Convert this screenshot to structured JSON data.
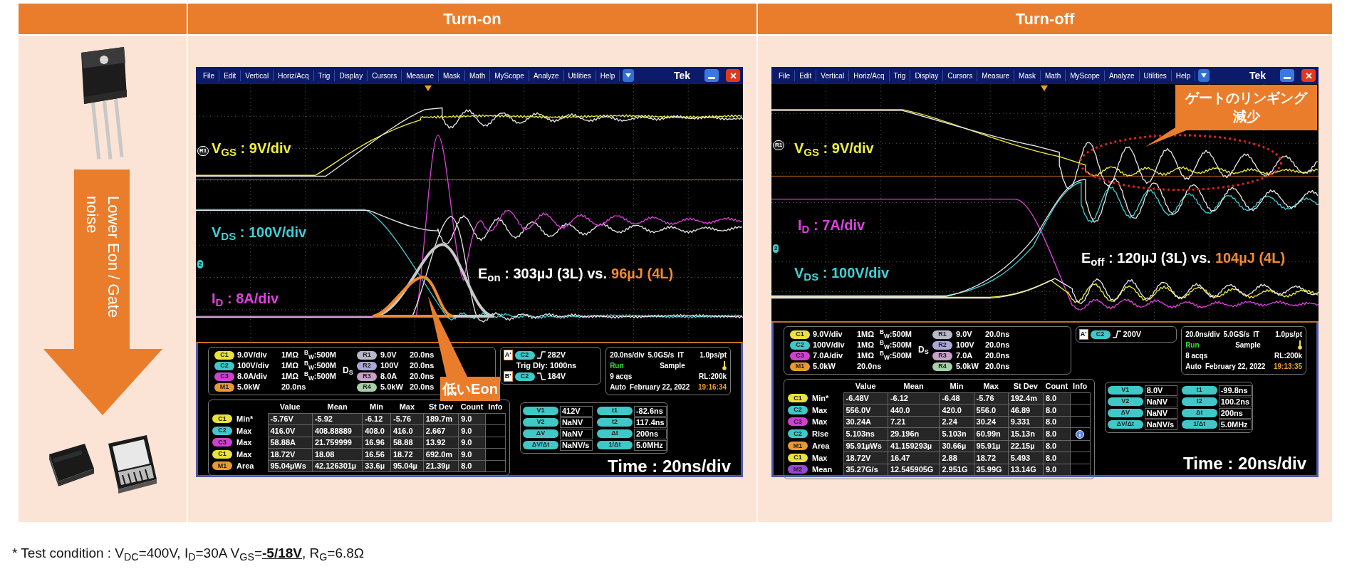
{
  "left_panel": {
    "arrow_label": "Lower Eon / Gate noise"
  },
  "sections": [
    {
      "title": "Turn-on",
      "scope": {
        "menu": [
          "File",
          "Edit",
          "Vertical",
          "Horiz/Acq",
          "Trig",
          "Display",
          "Cursors",
          "Measure",
          "Mask",
          "Math",
          "MyScope",
          "Analyze",
          "Utilities",
          "Help"
        ],
        "brand": "Tek",
        "markers": [
          "R1",
          "2"
        ],
        "trace_labels": [
          {
            "text": "V$_{GS}$ : 9V/div",
            "color": "#f2f03a"
          },
          {
            "text": "V$_{DS}$ : 100V/div",
            "color": "#3fd0d8"
          },
          {
            "text": "I$_{D}$ : 8A/div",
            "color": "#e040e0"
          }
        ],
        "energy": {
          "main": "E$_{on}$ : 303µJ (3L) vs.",
          "highlight": "96µJ (4L)"
        },
        "callout": "低いEon",
        "channels": [
          {
            "badge": "C1",
            "color": "#e8e23c",
            "scale": "9.0V/div",
            "impedance": "1MΩ",
            "bandwidth": "$^{B}$$_{W}$:500M"
          },
          {
            "badge": "C2",
            "color": "#40c8c8",
            "scale": "100V/div",
            "impedance": "1MΩ",
            "bandwidth": "$^{B}$$_{W}$:500M"
          },
          {
            "badge": "C3",
            "color": "#d040d0",
            "scale": "8.0A/div",
            "impedance": "1MΩ",
            "bandwidth": "$^{B}$$_{W}$:500M"
          },
          {
            "badge": "M1",
            "color": "#e89a30",
            "scale": "5.0kW",
            "timebase": "20.0ns"
          }
        ],
        "ds_label": "D$_{S}$",
        "references": [
          {
            "badge": "R1",
            "color": "#b8b8c8",
            "value": "9.0V",
            "timebase": "20.0ns"
          },
          {
            "badge": "R2",
            "color": "#a8a8d8",
            "value": "100V",
            "timebase": "20.0ns"
          },
          {
            "badge": "R3",
            "color": "#c8a0c8",
            "value": "8.0A",
            "timebase": "20.0ns"
          },
          {
            "badge": "R4",
            "color": "#a8d0a8",
            "value": "5.0kW",
            "timebase": "20.0ns"
          }
        ],
        "trigger": [
          {
            "tag": "A'",
            "channel": "C2",
            "falling": false,
            "level": "282V"
          },
          {
            "text": "Trig Dly: 1000ns"
          },
          {
            "tag": "B'",
            "channel": "C2",
            "falling": true,
            "level": "184V"
          }
        ],
        "acquisition": {
          "rate": "20.0ns/div",
          "sample_rate": "5.0GS/s",
          "mode": "IT",
          "resolution": "1.0ps/pt",
          "state": "Run",
          "acq_mode": "Sample",
          "acqs": "9 acqs",
          "record_length": "RL:200k",
          "trigger_mode": "Auto",
          "date": "February 22, 2022",
          "time": "19:16:34"
        },
        "measure_columns": [
          "Value",
          "Mean",
          "Min",
          "Max",
          "St Dev",
          "Count",
          "Info"
        ],
        "measurements": [
          {
            "badge": "C1",
            "color": "#e8e23c",
            "label": "Min*",
            "cells": [
              "-5.76V",
              "-5.92",
              "-6.12",
              "-5.76",
              "189.7m",
              "9.0"
            ],
            "info": false
          },
          {
            "badge": "C2",
            "color": "#40c8c8",
            "label": "Max",
            "cells": [
              "416.0V",
              "408.88889",
              "408.0",
              "416.0",
              "2.667",
              "9.0"
            ],
            "info": false
          },
          {
            "badge": "C3",
            "color": "#d040d0",
            "label": "Max",
            "cells": [
              "58.88A",
              "21.759999",
              "16.96",
              "58.88",
              "13.92",
              "9.0"
            ],
            "info": false
          },
          {
            "badge": "C1",
            "color": "#e8e23c",
            "label": "Max",
            "cells": [
              "18.72V",
              "18.08",
              "16.56",
              "18.72",
              "692.0m",
              "9.0"
            ],
            "info": false
          },
          {
            "badge": "M1",
            "color": "#e89a30",
            "label": "Area",
            "cells": [
              "95.04µWs",
              "42.126301µ",
              "33.6µ",
              "95.04µ",
              "21.39µ",
              "8.0"
            ],
            "info": false
          }
        ],
        "cursors": [
          {
            "left": {
              "badge": "V1",
              "value": "412V"
            },
            "right": {
              "badge": "t1",
              "value": "-82.6ns"
            }
          },
          {
            "left": {
              "badge": "V2",
              "value": "NaNV"
            },
            "right": {
              "badge": "t2",
              "value": "117.4ns"
            }
          },
          {
            "left": {
              "badge": "ΔV",
              "value": "NaNV"
            },
            "right": {
              "badge": "Δt",
              "value": "200ns"
            }
          },
          {
            "left": {
              "badge": "ΔV/Δt",
              "value": "NaNV/s"
            },
            "right": {
              "badge": "1/Δt",
              "value": "5.0MHz"
            }
          }
        ],
        "time_label": "Time : 20ns/div"
      }
    },
    {
      "title": "Turn-off",
      "scope": {
        "menu": [
          "File",
          "Edit",
          "Vertical",
          "Horiz/Acq",
          "Trig",
          "Display",
          "Cursors",
          "Measure",
          "Mask",
          "Math",
          "MyScope",
          "Analyze",
          "Utilities",
          "Help"
        ],
        "brand": "Tek",
        "markers": [
          "R1",
          "2"
        ],
        "trace_labels": [
          {
            "text": "V$_{GS}$ : 9V/div",
            "color": "#f2f03a"
          },
          {
            "text": "I$_{D}$ : 7A/div",
            "color": "#e040e0"
          },
          {
            "text": "V$_{DS}$ : 100V/div",
            "color": "#3fd0d8"
          }
        ],
        "energy": {
          "main": "E$_{off}$ : 120µJ (3L) vs.",
          "highlight": "104µJ (4L)"
        },
        "callout": "ゲートのリンギング減少",
        "channels": [
          {
            "badge": "C1",
            "color": "#e8e23c",
            "scale": "9.0V/div",
            "impedance": "1MΩ",
            "bandwidth": "$^{B}$$_{W}$:500M"
          },
          {
            "badge": "C2",
            "color": "#40c8c8",
            "scale": "100V/div",
            "impedance": "1MΩ",
            "bandwidth": "$^{B}$$_{W}$:500M"
          },
          {
            "badge": "C3",
            "color": "#d040d0",
            "scale": "7.0A/div",
            "impedance": "1MΩ",
            "bandwidth": "$^{B}$$_{W}$:500M"
          },
          {
            "badge": "M1",
            "color": "#e89a30",
            "scale": "5.0kW",
            "timebase": "20.0ns"
          }
        ],
        "ds_label": "D$_{S}$",
        "references": [
          {
            "badge": "R1",
            "color": "#b8b8c8",
            "value": "9.0V",
            "timebase": "20.0ns"
          },
          {
            "badge": "R2",
            "color": "#a8a8d8",
            "value": "100V",
            "timebase": "20.0ns"
          },
          {
            "badge": "R3",
            "color": "#c8a0c8",
            "value": "7.0A",
            "timebase": "20.0ns"
          },
          {
            "badge": "R4",
            "color": "#a8d0a8",
            "value": "5.0kW",
            "timebase": "20.0ns"
          }
        ],
        "trigger": [
          {
            "tag": "A'",
            "channel": "C2",
            "falling": false,
            "level": "200V"
          }
        ],
        "acquisition": {
          "rate": "20.0ns/div",
          "sample_rate": "5.0GS/s",
          "mode": "IT",
          "resolution": "1.0ps/pt",
          "state": "Run",
          "acq_mode": "Sample",
          "acqs": "8 acqs",
          "record_length": "RL:200k",
          "trigger_mode": "Auto",
          "date": "February 22, 2022",
          "time": "19:13:35"
        },
        "measure_columns": [
          "Value",
          "Mean",
          "Min",
          "Max",
          "St Dev",
          "Count",
          "Info"
        ],
        "measurements": [
          {
            "badge": "C1",
            "color": "#e8e23c",
            "label": "Min*",
            "cells": [
              "-6.48V",
              "-6.12",
              "-6.48",
              "-5.76",
              "192.4m",
              "8.0"
            ],
            "info": false
          },
          {
            "badge": "C2",
            "color": "#40c8c8",
            "label": "Max",
            "cells": [
              "556.0V",
              "440.0",
              "420.0",
              "556.0",
              "46.89",
              "8.0"
            ],
            "info": false
          },
          {
            "badge": "C3",
            "color": "#d040d0",
            "label": "Max",
            "cells": [
              "30.24A",
              "7.21",
              "2.24",
              "30.24",
              "9.331",
              "8.0"
            ],
            "info": false
          },
          {
            "badge": "C2",
            "color": "#40c8c8",
            "label": "Rise",
            "cells": [
              "5.103ns",
              "29.196n",
              "5.103n",
              "60.99n",
              "15.13n",
              "8.0"
            ],
            "info": true
          },
          {
            "badge": "M1",
            "color": "#e89a30",
            "label": "Area",
            "cells": [
              "95.91µWs",
              "41.159293µ",
              "30.66µ",
              "95.91µ",
              "22.15µ",
              "8.0"
            ],
            "info": false
          },
          {
            "badge": "C1",
            "color": "#e8e23c",
            "label": "Max",
            "cells": [
              "18.72V",
              "16.47",
              "2.88",
              "18.72",
              "5.493",
              "8.0"
            ],
            "info": false
          },
          {
            "badge": "M2",
            "color": "#9848d8",
            "label": "Mean",
            "cells": [
              "35.27G/s",
              "12.545905G",
              "2.951G",
              "35.99G",
              "13.14G",
              "9.0"
            ],
            "info": false
          }
        ],
        "cursors": [
          {
            "left": {
              "badge": "V1",
              "value": "8.0V"
            },
            "right": {
              "badge": "t1",
              "value": "-99.8ns"
            }
          },
          {
            "left": {
              "badge": "V2",
              "value": "NaNV"
            },
            "right": {
              "badge": "t2",
              "value": "100.2ns"
            }
          },
          {
            "left": {
              "badge": "ΔV",
              "value": "NaNV"
            },
            "right": {
              "badge": "Δt",
              "value": "200ns"
            }
          },
          {
            "left": {
              "badge": "ΔV/Δt",
              "value": "NaNV/s"
            },
            "right": {
              "badge": "1/Δt",
              "value": "5.0MHz"
            }
          }
        ],
        "time_label": "Time : 20ns/div"
      }
    }
  ],
  "footnote": {
    "marker": "*",
    "text": "Test condition : V$_{DC}$=400V, I$_{D}$=30A V$_{GS}$=**-5/18V**, R$_{G}$=6.8Ω"
  }
}
